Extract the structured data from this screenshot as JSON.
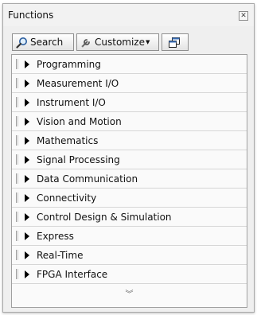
{
  "palette": {
    "title": "Functions",
    "close_glyph": "✕",
    "toolbar": {
      "search_label": "Search",
      "customize_label": "Customize",
      "customize_arrow": "▼"
    },
    "categories": [
      "Programming",
      "Measurement I/O",
      "Instrument I/O",
      "Vision and Motion",
      "Mathematics",
      "Signal Processing",
      "Data Communication",
      "Connectivity",
      "Control Design & Simulation",
      "Express",
      "Real-Time",
      "FPGA Interface"
    ],
    "more_glyph": "︾"
  },
  "icons": {
    "search": "magnifier-icon",
    "customize": "wrench-icon",
    "view": "palette-view-icon",
    "expand": "triangle-right-icon",
    "more": "double-chevron-down-icon"
  }
}
